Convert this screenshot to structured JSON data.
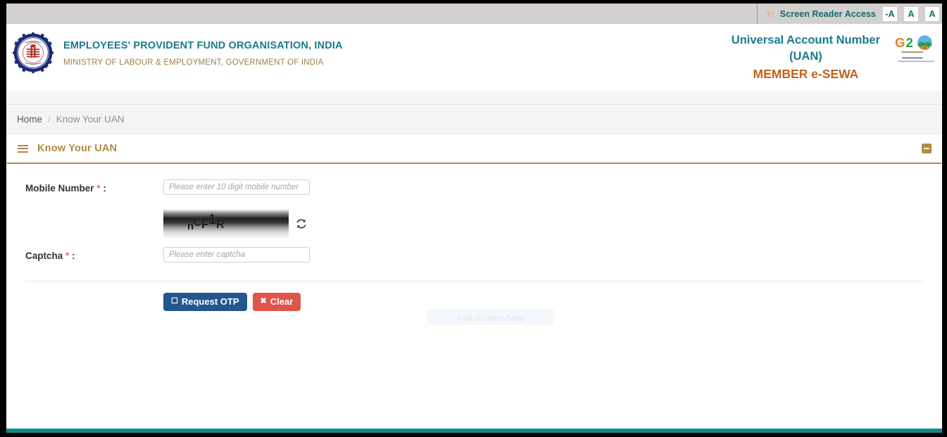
{
  "topbar": {
    "hand_icon": "pointing-hand-icon",
    "screen_reader_label": "Screen Reader Access",
    "font_buttons": [
      {
        "label": "-A",
        "name": "font-decrease"
      },
      {
        "label": "A",
        "name": "font-normal"
      },
      {
        "label": "A",
        "name": "font-increase"
      }
    ]
  },
  "header": {
    "seal_icon": "epfo-emblem-icon",
    "org_title": "EMPLOYEES' PROVIDENT FUND ORGANISATION, INDIA",
    "org_subtitle": "MINISTRY OF LABOUR & EMPLOYMENT, GOVERNMENT OF INDIA",
    "uan_line1": "Universal Account Number",
    "uan_line2": "(UAN)",
    "uan_line3": "MEMBER e-SEWA",
    "g20_icon": "g20-india-logo",
    "g20_text": "G20",
    "g20_tagline": "ONE EARTH • ONE FAMILY • ONE FUTURE",
    "colors": {
      "teal": "#1b7b8c",
      "brown": "#9f7d4a",
      "orange": "#c0621f",
      "topbar_bg": "#d3d0cf"
    }
  },
  "breadcrumb": {
    "home": "Home",
    "separator": "/",
    "current": "Know Your UAN"
  },
  "panel": {
    "menu_icon": "hamburger-menu-icon",
    "title": "Know Your UAN",
    "collapse_icon": "minus-collapse-icon",
    "accent_color": "#b08a45"
  },
  "overlay": {
    "snip_label": "Full-screen Snip"
  },
  "form": {
    "mobile": {
      "label": "Mobile Number",
      "required_mark": "*",
      "colon": ":",
      "placeholder": "Please enter 10 digit mobile number",
      "value": ""
    },
    "captcha_image": {
      "text": "nCF1R",
      "chars": [
        "n",
        "C",
        "F",
        "1",
        "R"
      ],
      "refresh_icon": "refresh-icon"
    },
    "captcha": {
      "label": "Captcha",
      "required_mark": "*",
      "colon": ":",
      "placeholder": "Please enter captcha",
      "value": ""
    },
    "buttons": {
      "request_otp": {
        "label": "Request OTP",
        "icon": "key-icon",
        "color": "#20578f"
      },
      "clear": {
        "label": "Clear",
        "icon": "times-icon",
        "color": "#e0554b"
      }
    }
  },
  "footer": {
    "bar_color": "#0f8c8c"
  }
}
